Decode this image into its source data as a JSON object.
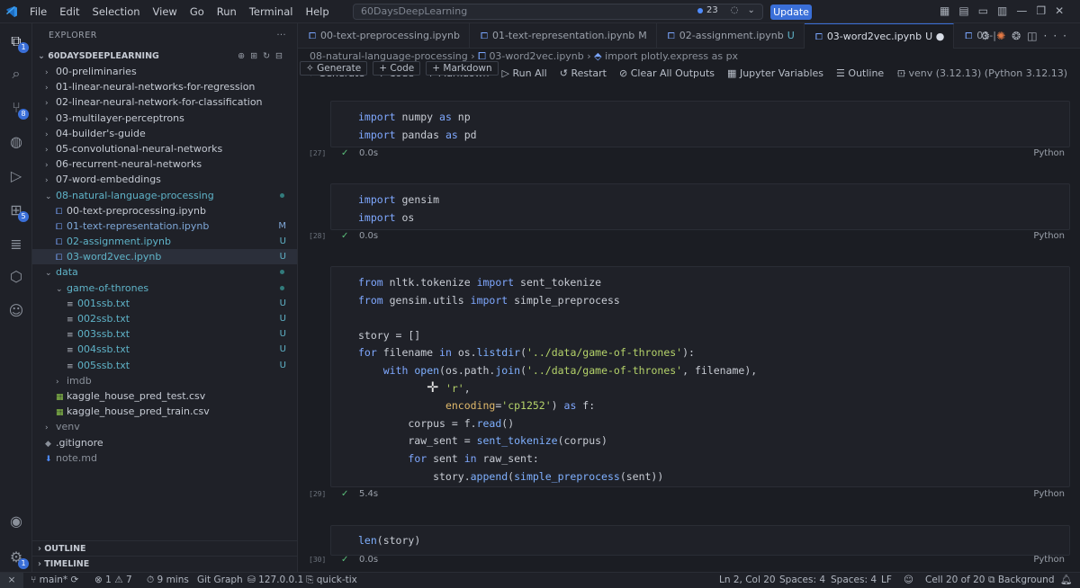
{
  "titlebar": {
    "menu": [
      "File",
      "Edit",
      "Selection",
      "View",
      "Go",
      "Run",
      "Terminal",
      "Help"
    ],
    "search_text": "60DaysDeepLearning",
    "notification_count": "23",
    "update_label": "Update"
  },
  "activity": {
    "explorer_badge": "1",
    "scm_badge": "8",
    "extensions_badge": "5",
    "accounts_badge": "1"
  },
  "explorer": {
    "title": "EXPLORER",
    "root": "60DAYSDEEPLEARNING",
    "items": [
      {
        "label": "00-preliminaries",
        "indent": 1,
        "kind": "folder",
        "open": false,
        "deco": "",
        "color": "#c5cad3"
      },
      {
        "label": "01-linear-neural-networks-for-regression",
        "indent": 1,
        "kind": "folder",
        "open": false,
        "deco": "",
        "color": "#c5cad3"
      },
      {
        "label": "02-linear-neural-network-for-classification",
        "indent": 1,
        "kind": "folder",
        "open": false,
        "deco": "",
        "color": "#c5cad3"
      },
      {
        "label": "03-multilayer-perceptrons",
        "indent": 1,
        "kind": "folder",
        "open": false,
        "deco": "",
        "color": "#c5cad3"
      },
      {
        "label": "04-builder's-guide",
        "indent": 1,
        "kind": "folder",
        "open": false,
        "deco": "",
        "color": "#c5cad3"
      },
      {
        "label": "05-convolutional-neural-networks",
        "indent": 1,
        "kind": "folder",
        "open": false,
        "deco": "",
        "color": "#c5cad3"
      },
      {
        "label": "06-recurrent-neural-networks",
        "indent": 1,
        "kind": "folder",
        "open": false,
        "deco": "",
        "color": "#c5cad3"
      },
      {
        "label": "07-word-embeddings",
        "indent": 1,
        "kind": "folder",
        "open": false,
        "deco": "",
        "color": "#c5cad3"
      },
      {
        "label": "08-natural-language-processing",
        "indent": 1,
        "kind": "folder",
        "open": true,
        "deco": "dot",
        "color": "#5fb3c8"
      },
      {
        "label": "00-text-preprocessing.ipynb",
        "indent": 2,
        "kind": "notebook",
        "deco": "",
        "color": "#c5cad3"
      },
      {
        "label": "01-text-representation.ipynb",
        "indent": 2,
        "kind": "notebook",
        "deco": "M",
        "color": "#7fa8d8"
      },
      {
        "label": "02-assignment.ipynb",
        "indent": 2,
        "kind": "notebook",
        "deco": "U",
        "color": "#5fb3c8"
      },
      {
        "label": "03-word2vec.ipynb",
        "indent": 2,
        "kind": "notebook",
        "deco": "U",
        "color": "#5fb3c8",
        "selected": true
      },
      {
        "label": "data",
        "indent": 1,
        "kind": "folder",
        "open": true,
        "deco": "dot",
        "color": "#5fb3c8"
      },
      {
        "label": "game-of-thrones",
        "indent": 2,
        "kind": "folder",
        "open": true,
        "deco": "dot",
        "color": "#5fb3c8"
      },
      {
        "label": "001ssb.txt",
        "indent": 3,
        "kind": "text",
        "deco": "U",
        "color": "#5fb3c8"
      },
      {
        "label": "002ssb.txt",
        "indent": 3,
        "kind": "text",
        "deco": "U",
        "color": "#5fb3c8"
      },
      {
        "label": "003ssb.txt",
        "indent": 3,
        "kind": "text",
        "deco": "U",
        "color": "#5fb3c8"
      },
      {
        "label": "004ssb.txt",
        "indent": 3,
        "kind": "text",
        "deco": "U",
        "color": "#5fb3c8"
      },
      {
        "label": "005ssb.txt",
        "indent": 3,
        "kind": "text",
        "deco": "U",
        "color": "#5fb3c8"
      },
      {
        "label": "imdb",
        "indent": 2,
        "kind": "folder",
        "open": false,
        "deco": "",
        "color": "#8a909a"
      },
      {
        "label": "kaggle_house_pred_test.csv",
        "indent": 2,
        "kind": "csv",
        "deco": "",
        "color": "#c5cad3"
      },
      {
        "label": "kaggle_house_pred_train.csv",
        "indent": 2,
        "kind": "csv",
        "deco": "",
        "color": "#c5cad3"
      },
      {
        "label": "venv",
        "indent": 1,
        "kind": "folder",
        "open": false,
        "deco": "",
        "color": "#8a909a"
      },
      {
        "label": ".gitignore",
        "indent": 1,
        "kind": "gitignore",
        "deco": "",
        "color": "#c5cad3"
      },
      {
        "label": "note.md",
        "indent": 1,
        "kind": "markdown",
        "deco": "",
        "color": "#8a909a"
      }
    ],
    "outline_label": "OUTLINE",
    "timeline_label": "TIMELINE"
  },
  "tabs": [
    {
      "label": "00-text-preprocessing.ipynb",
      "status": "",
      "active": false
    },
    {
      "label": "01-text-representation.ipynb",
      "status": "M",
      "active": false
    },
    {
      "label": "02-assignment.ipynb",
      "status": "U",
      "active": false
    },
    {
      "label": "03-word2vec.ipynb",
      "status": "U ●",
      "active": true
    },
    {
      "label": "01-|",
      "status": "",
      "active": false
    }
  ],
  "breadcrumb": [
    "08-natural-language-processing",
    "03-word2vec.ipynb",
    "import plotly.express as px"
  ],
  "toolbar": {
    "generate": "Generate",
    "code": "Code",
    "markdown": "Markdown",
    "run_all": "Run All",
    "restart": "Restart",
    "clear_outputs": "Clear All Outputs",
    "variables": "Jupyter Variables",
    "outline": "Outline",
    "more": "···",
    "kernel": "venv (3.12.13) (Python 3.12.13)"
  },
  "insert": {
    "generate": "Generate",
    "code": "Code",
    "markdown": "Markdown"
  },
  "cells": [
    {
      "exec": "[27]",
      "time": "0.0s",
      "lang": "Python"
    },
    {
      "exec": "[28]",
      "time": "0.0s",
      "lang": "Python"
    },
    {
      "exec": "[29]",
      "time": "5.4s",
      "lang": "Python"
    },
    {
      "exec": "[30]",
      "time": "0.0s",
      "lang": "Python"
    }
  ],
  "statusbar": {
    "branch": "main*",
    "errors": "1",
    "warnings": "7",
    "time_tracker": "9 mins",
    "git_graph": "Git Graph",
    "host": "127.0.0.1",
    "quick": "quick-tix",
    "position": "Ln 2, Col 20",
    "spaces1": "Spaces: 4",
    "spaces2": "Spaces: 4",
    "eol": "LF",
    "cell": "Cell 20 of 20",
    "background": "Background"
  }
}
